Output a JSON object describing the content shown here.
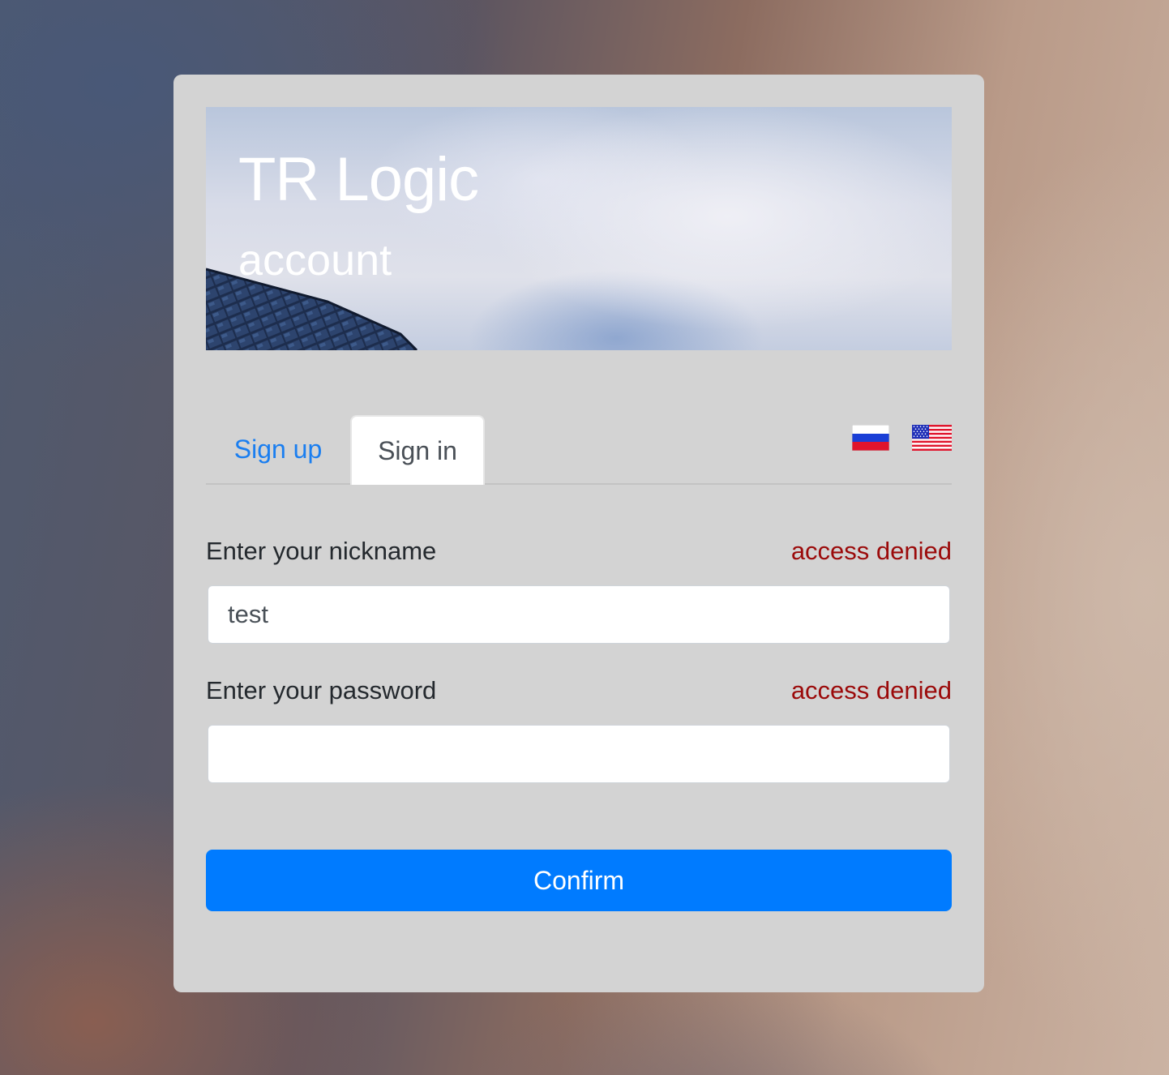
{
  "banner": {
    "title": "TR Logic",
    "subtitle": "account"
  },
  "tabs": [
    {
      "label": "Sign up",
      "active": false
    },
    {
      "label": "Sign in",
      "active": true
    }
  ],
  "languages": [
    {
      "code": "ru",
      "icon": "russia-flag-icon"
    },
    {
      "code": "en",
      "icon": "us-flag-icon"
    }
  ],
  "form": {
    "nickname": {
      "label": "Enter your nickname",
      "value": "test",
      "error": "access denied"
    },
    "password": {
      "label": "Enter your password",
      "value": "",
      "error": "access denied"
    },
    "submit_label": "Confirm"
  },
  "colors": {
    "accent": "#007bff",
    "error": "#9b0a0a",
    "card_background": "#d3d3d3"
  }
}
